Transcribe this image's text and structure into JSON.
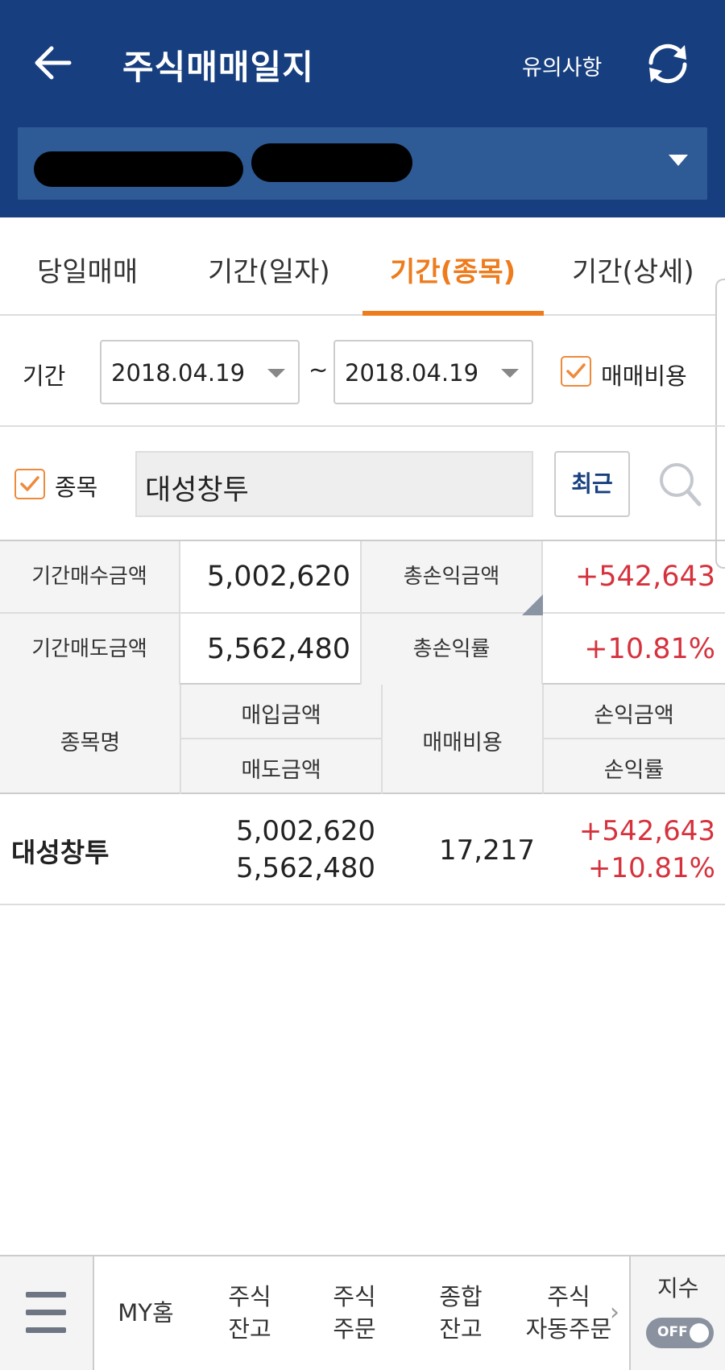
{
  "header": {
    "title": "주식매매일지",
    "notice_label": "유의사항",
    "back_icon": "arrow-left-icon",
    "refresh_icon": "refresh-icon"
  },
  "tabs": [
    {
      "label": "당일매매",
      "active": false
    },
    {
      "label": "기간(일자)",
      "active": false
    },
    {
      "label": "기간(종목)",
      "active": true
    },
    {
      "label": "기간(상세)",
      "active": false
    }
  ],
  "filter": {
    "period_label": "기간",
    "start_date": "2018.04.19",
    "separator": "~",
    "end_date": "2018.04.19",
    "cost_label": "매매비용",
    "cost_checked": true,
    "item_label": "종목",
    "item_checked": true,
    "item_value": "대성창투",
    "recent_label": "최근"
  },
  "summary": {
    "buy_label": "기간매수금액",
    "buy_value": "5,002,620",
    "sell_label": "기간매도금액",
    "sell_value": "5,562,480",
    "total_pl_label": "총손익금액",
    "total_pl_value": "+542,643",
    "total_rate_label": "총손익률",
    "total_rate_value": "+10.81%"
  },
  "table": {
    "headers": {
      "name": "종목명",
      "buy_amount": "매입금액",
      "sell_amount": "매도금액",
      "cost": "매매비용",
      "pl_amount": "손익금액",
      "pl_rate": "손익률"
    },
    "rows": [
      {
        "name": "대성창투",
        "buy": "5,002,620",
        "sell": "5,562,480",
        "cost": "17,217",
        "pl": "+542,643",
        "rate": "+10.81%"
      }
    ]
  },
  "bottom_nav": {
    "items": [
      {
        "line1": "MY홈",
        "line2": ""
      },
      {
        "line1": "주식",
        "line2": "잔고"
      },
      {
        "line1": "주식",
        "line2": "주문"
      },
      {
        "line1": "종합",
        "line2": "잔고"
      },
      {
        "line1": "주식",
        "line2": "자동주문"
      }
    ],
    "index_label": "지수",
    "toggle_text": "OFF"
  },
  "colors": {
    "header_bg": "#173f7f",
    "accent": "#ee7b1c",
    "profit_red": "#d6323d",
    "sell_blue": "#3a7fd0"
  }
}
